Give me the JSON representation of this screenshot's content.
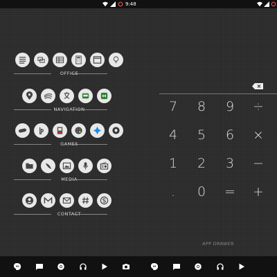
{
  "status_bar": {
    "time": "9:48"
  },
  "groups": [
    {
      "label": "OFFICE",
      "icons": [
        "notes-icon",
        "slides-icon",
        "sheets-icon",
        "calculator-icon",
        "browser-window-icon",
        "lightbulb-icon"
      ]
    },
    {
      "label": "NAVIGATION",
      "icons": [
        "maps-pin-icon",
        "earth-icon",
        "translate-icon",
        "transit-icon",
        "stumble-icon"
      ]
    },
    {
      "label": "GAMES",
      "icons": [
        "gamepad-icon",
        "playstation-icon",
        "arcade-icon",
        "emulator-icon",
        "psp-icon",
        "soccer-ball-icon"
      ]
    },
    {
      "label": "MEDIA",
      "icons": [
        "folder-icon",
        "feather-icon",
        "gallery-icon",
        "microphone-icon",
        "radio-icon"
      ]
    },
    {
      "label": "CONTACT",
      "icons": [
        "contacts-icon",
        "gmail-icon",
        "email-icon",
        "hashtag-icon",
        "skype-icon"
      ]
    }
  ],
  "calculator": {
    "keys": [
      "7",
      "8",
      "9",
      "÷",
      "4",
      "5",
      "6",
      "×",
      "1",
      "2",
      "3",
      "−",
      ".",
      "0",
      "=",
      "+"
    ]
  },
  "app_drawer": "APP DRAWER",
  "dock_left": [
    "hangouts-icon",
    "messages-icon",
    "chrome-icon",
    "headphones-icon",
    "play-store-icon",
    "camera-icon"
  ],
  "dock_right": [
    "phone-icon",
    "messages-icon",
    "chrome-icon",
    "headphones-icon",
    "play-store-icon"
  ]
}
